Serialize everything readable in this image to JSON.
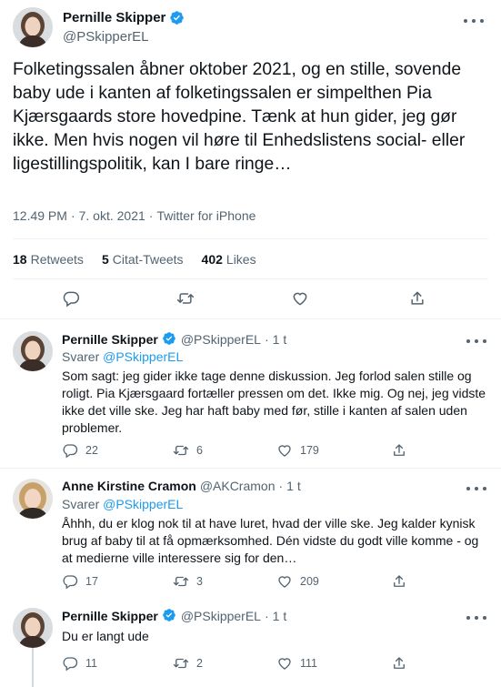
{
  "main_tweet": {
    "author_name": "Pernille Skipper",
    "handle": "@PSkipperEL",
    "text": "Folketingssalen åbner oktober 2021, og en stille, sovende baby ude i kanten af folketingssalen er simpelthen Pia Kjærsgaards store hovedpine. Tænk at hun gider, jeg gør ikke. Men hvis nogen vil høre til Enhedslistens social- eller ligestillingspolitik, kan I bare ringe…",
    "time": "12.49 PM",
    "date": "7. okt. 2021",
    "source": "Twitter for iPhone",
    "stats": {
      "retweets_count": "18",
      "retweets_label": "Retweets",
      "quotes_count": "5",
      "quotes_label": "Citat-Tweets",
      "likes_count": "402",
      "likes_label": "Likes"
    }
  },
  "replies": [
    {
      "author_name": "Pernille Skipper",
      "handle": "@PSkipperEL",
      "age": "1 t",
      "replying_label": "Svarer",
      "replying_to": "@PSkipperEL",
      "text": "Som sagt: jeg gider ikke tage denne diskussion. Jeg forlod salen stille og roligt. Pia Kjærsgaard fortæller pressen om det. Ikke mig.  Og nej, jeg vidste ikke det ville ske. Jeg har haft baby med før, stille i kanten af salen uden problemer.",
      "replies": "22",
      "retweets": "6",
      "likes": "179",
      "verified": true
    },
    {
      "author_name": "Anne Kirstine Cramon",
      "handle": "@AKCramon",
      "age": "1 t",
      "replying_label": "Svarer",
      "replying_to": "@PSkipperEL",
      "text": "Åhhh, du er klog nok til at have luret, hvad der ville ske. Jeg kalder kynisk brug af baby til at få opmærksomhed. Dén vidste du godt ville komme - og at medierne ville interessere sig for den…",
      "replies": "17",
      "retweets": "3",
      "likes": "209",
      "verified": false
    },
    {
      "author_name": "Pernille Skipper",
      "handle": "@PSkipperEL",
      "age": "1 t",
      "text": "Du er langt ude",
      "replies": "11",
      "retweets": "2",
      "likes": "111",
      "verified": true
    }
  ],
  "colors": {
    "accent": "#1d9bf0",
    "text": "#0f1419",
    "muted": "#536471",
    "divider": "#eff3f4"
  }
}
